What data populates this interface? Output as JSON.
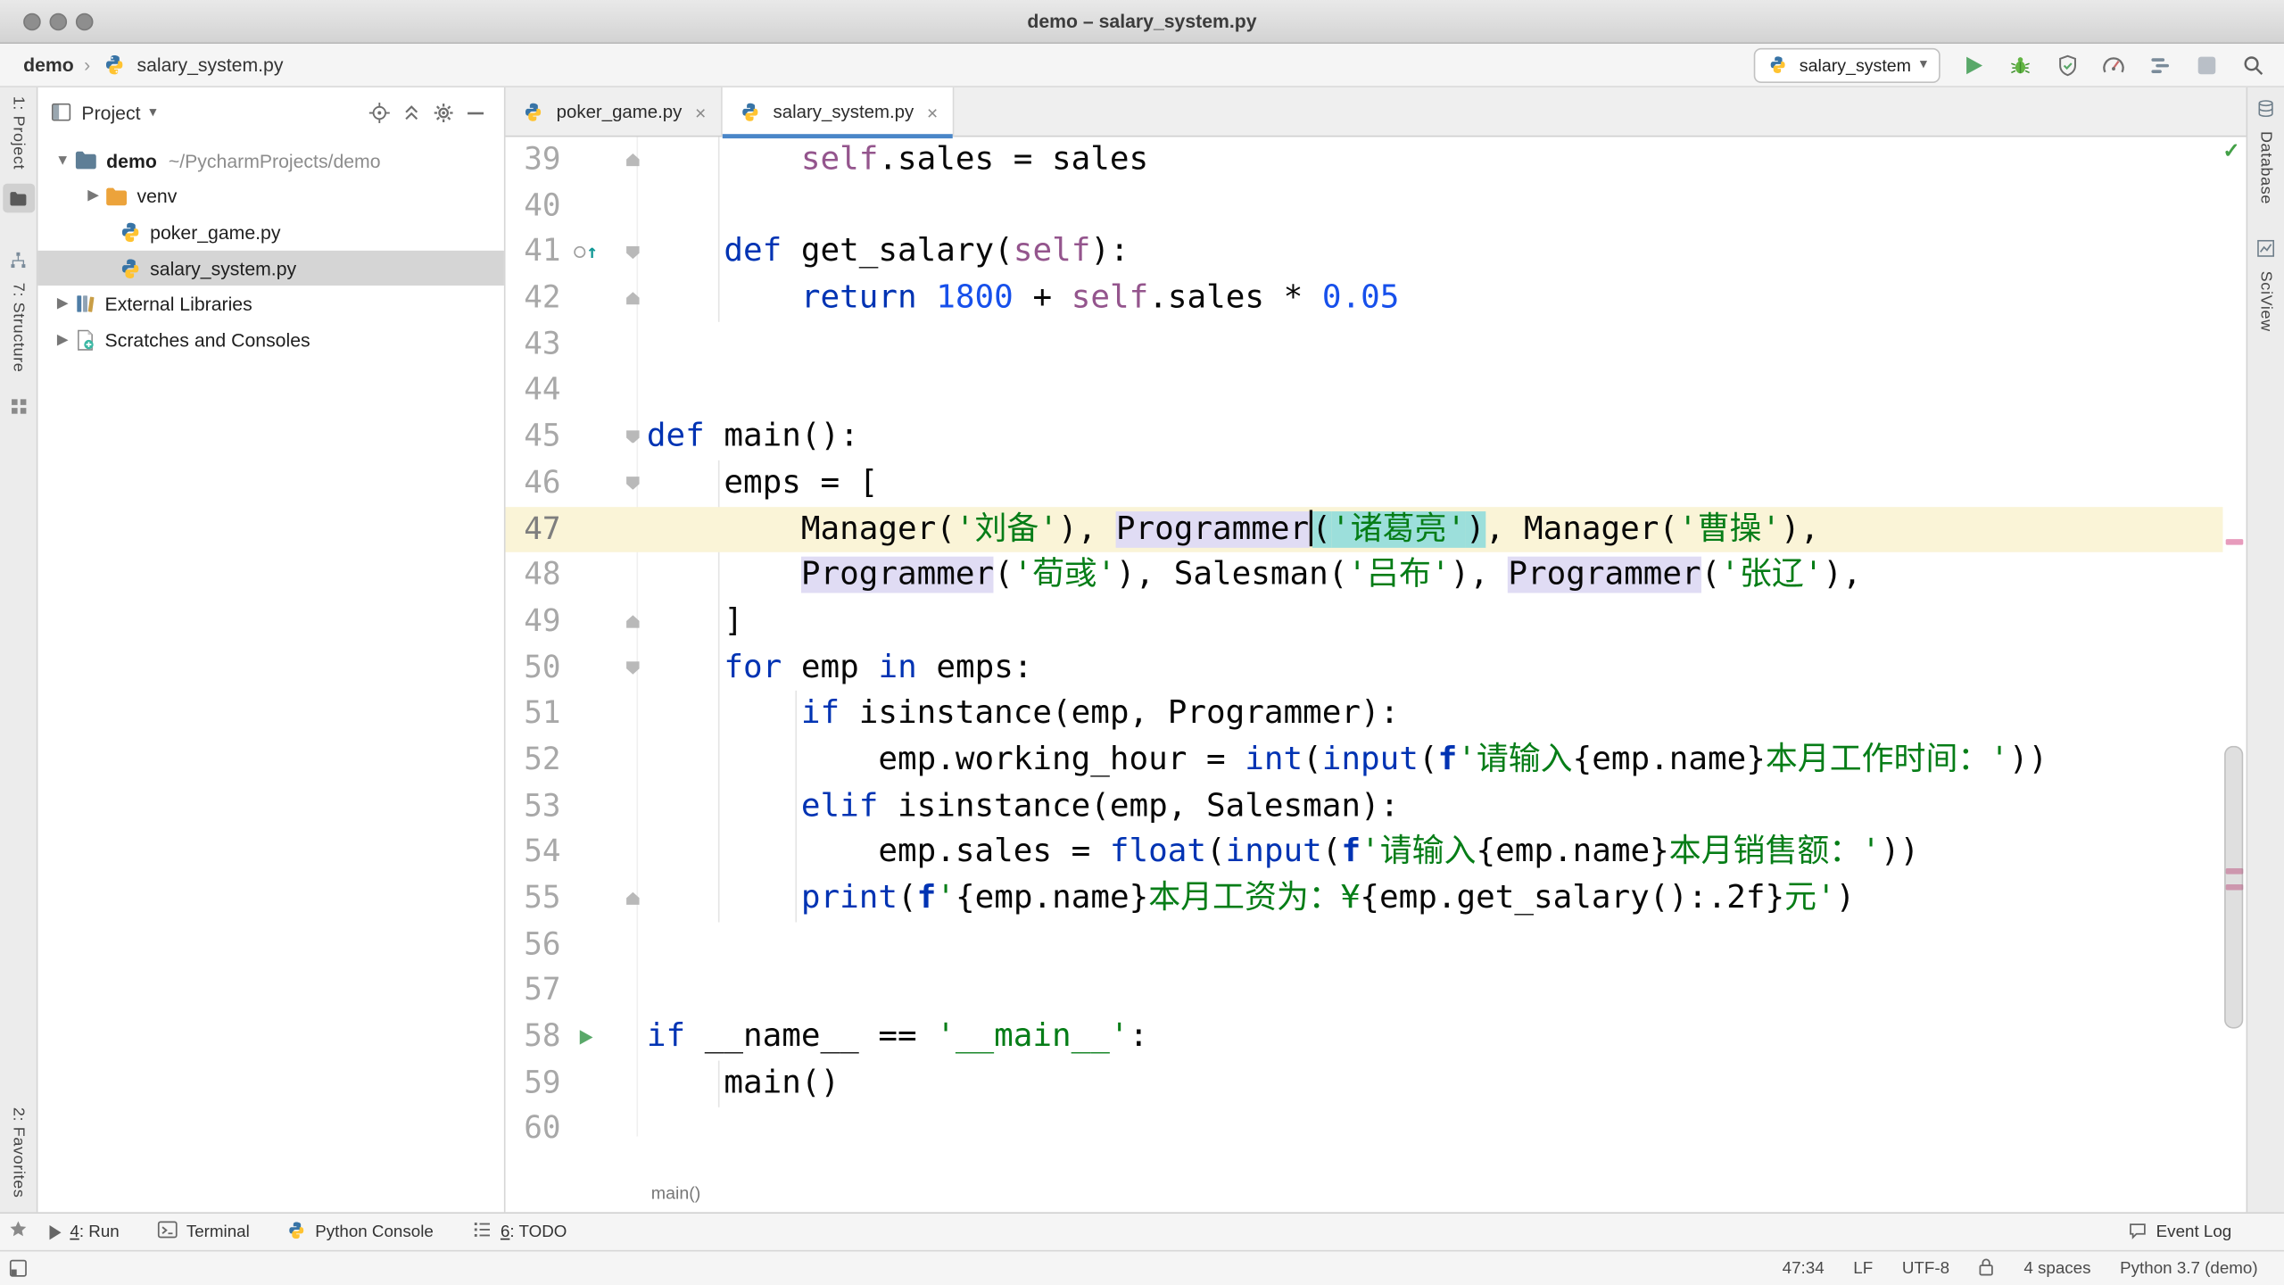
{
  "window": {
    "title": "demo – salary_system.py"
  },
  "toolbar": {
    "breadcrumb": {
      "project": "demo",
      "separator": "›",
      "file": "salary_system.py"
    },
    "run_config": "salary_system"
  },
  "left_stripe": {
    "project": "1: Project",
    "structure": "7: Structure",
    "favorites": "2: Favorites"
  },
  "right_stripe": {
    "database": "Database",
    "sciview": "SciView"
  },
  "project_panel": {
    "title": "Project",
    "tree": [
      {
        "label": "demo",
        "path": "~/PycharmProjects/demo"
      },
      {
        "label": "venv"
      },
      {
        "label": "poker_game.py"
      },
      {
        "label": "salary_system.py"
      },
      {
        "label": "External Libraries"
      },
      {
        "label": "Scratches and Consoles"
      }
    ]
  },
  "tabs": [
    {
      "label": "poker_game.py"
    },
    {
      "label": "salary_system.py"
    }
  ],
  "editor": {
    "breadcrumb": "main()",
    "lines": [
      {
        "n": 39,
        "f": "up",
        "t": [
          {
            "s": "        "
          },
          {
            "s": "self",
            "c": "self"
          },
          {
            "s": ".sales = sales"
          }
        ]
      },
      {
        "n": 40,
        "t": []
      },
      {
        "n": 41,
        "g": "ovr",
        "f": "down",
        "t": [
          {
            "s": "    "
          },
          {
            "s": "def",
            "c": "kw"
          },
          {
            "s": " get_salary("
          },
          {
            "s": "self",
            "c": "self"
          },
          {
            "s": "):"
          }
        ]
      },
      {
        "n": 42,
        "f": "up",
        "t": [
          {
            "s": "        "
          },
          {
            "s": "return",
            "c": "kw"
          },
          {
            "s": " "
          },
          {
            "s": "1800",
            "c": "num"
          },
          {
            "s": " + "
          },
          {
            "s": "self",
            "c": "self"
          },
          {
            "s": ".sales * "
          },
          {
            "s": "0.05",
            "c": "num"
          }
        ]
      },
      {
        "n": 43,
        "t": []
      },
      {
        "n": 44,
        "t": []
      },
      {
        "n": 45,
        "f": "down",
        "t": [
          {
            "s": "def",
            "c": "kw"
          },
          {
            "s": " main():"
          }
        ]
      },
      {
        "n": 46,
        "f": "down",
        "t": [
          {
            "s": "    emps = ["
          }
        ]
      },
      {
        "n": 47,
        "cur": true,
        "t": [
          {
            "s": "        Manager("
          },
          {
            "s": "'刘备'",
            "c": "str"
          },
          {
            "s": "), "
          },
          {
            "s": "Programmer",
            "b": "lav"
          },
          {
            "caret": true
          },
          {
            "s": "(",
            "b": "cyan"
          },
          {
            "s": "'诸葛亮'",
            "c": "str",
            "b": "cyan"
          },
          {
            "s": ")",
            "b": "cyan"
          },
          {
            "s": ", Manager("
          },
          {
            "s": "'曹操'",
            "c": "str"
          },
          {
            "s": "),"
          }
        ]
      },
      {
        "n": 48,
        "t": [
          {
            "s": "        "
          },
          {
            "s": "Programmer",
            "b": "lav"
          },
          {
            "s": "("
          },
          {
            "s": "'荀彧'",
            "c": "str"
          },
          {
            "s": "), Salesman("
          },
          {
            "s": "'吕布'",
            "c": "str"
          },
          {
            "s": "), "
          },
          {
            "s": "Programmer",
            "b": "lav"
          },
          {
            "s": "("
          },
          {
            "s": "'张辽'",
            "c": "str"
          },
          {
            "s": "),"
          }
        ]
      },
      {
        "n": 49,
        "f": "up",
        "t": [
          {
            "s": "    ]"
          }
        ]
      },
      {
        "n": 50,
        "f": "down",
        "t": [
          {
            "s": "    "
          },
          {
            "s": "for",
            "c": "kw"
          },
          {
            "s": " emp "
          },
          {
            "s": "in",
            "c": "kw"
          },
          {
            "s": " emps:"
          }
        ]
      },
      {
        "n": 51,
        "t": [
          {
            "s": "        "
          },
          {
            "s": "if",
            "c": "kw"
          },
          {
            "s": " isinstance(emp, Programmer):"
          }
        ]
      },
      {
        "n": 52,
        "t": [
          {
            "s": "            emp.working_hour = "
          },
          {
            "s": "int",
            "c": "kw"
          },
          {
            "s": "("
          },
          {
            "s": "input",
            "c": "kw"
          },
          {
            "s": "("
          },
          {
            "s": "f",
            "c": "fp"
          },
          {
            "s": "'请输入",
            "c": "str"
          },
          {
            "s": "{emp.name}"
          },
          {
            "s": "本月工作时间：'",
            "c": "str"
          },
          {
            "s": "))"
          }
        ]
      },
      {
        "n": 53,
        "t": [
          {
            "s": "        "
          },
          {
            "s": "elif",
            "c": "kw"
          },
          {
            "s": " isinstance(emp, Salesman):"
          }
        ]
      },
      {
        "n": 54,
        "t": [
          {
            "s": "            emp.sales = "
          },
          {
            "s": "float",
            "c": "kw"
          },
          {
            "s": "("
          },
          {
            "s": "input",
            "c": "kw"
          },
          {
            "s": "("
          },
          {
            "s": "f",
            "c": "fp"
          },
          {
            "s": "'请输入",
            "c": "str"
          },
          {
            "s": "{emp.name}"
          },
          {
            "s": "本月销售额：'",
            "c": "str"
          },
          {
            "s": "))"
          }
        ]
      },
      {
        "n": 55,
        "f": "up",
        "t": [
          {
            "s": "        "
          },
          {
            "s": "print",
            "c": "kw"
          },
          {
            "s": "("
          },
          {
            "s": "f",
            "c": "fp"
          },
          {
            "s": "'",
            "c": "str"
          },
          {
            "s": "{emp.name}"
          },
          {
            "s": "本月工资为：¥",
            "c": "str"
          },
          {
            "s": "{emp.get_salary():.2f}"
          },
          {
            "s": "元'",
            "c": "str"
          },
          {
            "s": ")"
          }
        ]
      },
      {
        "n": 56,
        "t": []
      },
      {
        "n": 57,
        "t": []
      },
      {
        "n": 58,
        "g": "run",
        "t": [
          {
            "s": "if",
            "c": "kw"
          },
          {
            "s": " __name__ == "
          },
          {
            "s": "'__main__'",
            "c": "str"
          },
          {
            "s": ":"
          }
        ]
      },
      {
        "n": 59,
        "t": [
          {
            "s": "    main()"
          }
        ]
      },
      {
        "n": 60,
        "t": []
      }
    ]
  },
  "bottom_stripe": {
    "left": [
      {
        "pre": "4",
        "rest": ": Run"
      },
      {
        "pre": "",
        "rest": "Terminal"
      },
      {
        "pre": "",
        "rest": "Python Console"
      },
      {
        "pre": "6",
        "rest": ": TODO"
      }
    ],
    "right": "Event Log"
  },
  "status_bar": {
    "caret_position": "47:34",
    "line_ending": "LF",
    "encoding": "UTF-8",
    "indent": "4 spaces",
    "interpreter": "Python 3.7 (demo)"
  },
  "colors": {
    "accent_blue": "#4A86C8",
    "run_green": "#59A869",
    "keyword": "#0033B3",
    "string": "#067D17",
    "number": "#1750EB",
    "self": "#94558D",
    "caret_line": "#FAF4D7",
    "identifier_highlight": "#E0DCF4",
    "selection_cyan": "#9CDFDB"
  }
}
